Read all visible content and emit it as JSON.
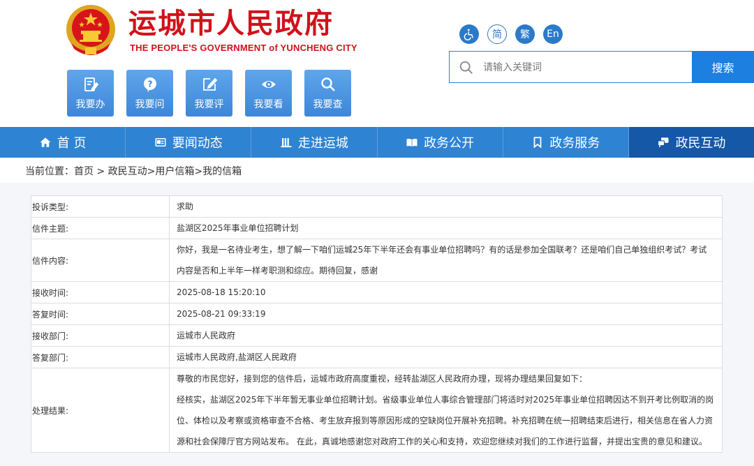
{
  "header": {
    "title": "运城市人民政府",
    "subtitle": "THE PEOPLE'S GOVERNMENT of YUNCHENG CITY",
    "quick_links": [
      {
        "label": "我要办",
        "icon": "edit-document-icon"
      },
      {
        "label": "我要问",
        "icon": "question-bubble-icon"
      },
      {
        "label": "我要评",
        "icon": "pencil-square-icon"
      },
      {
        "label": "我要看",
        "icon": "eye-icon"
      },
      {
        "label": "我要查",
        "icon": "search-icon"
      }
    ],
    "tools": {
      "accessibility_icon": "wheelchair-icon",
      "simplified": "简",
      "traditional": "繁",
      "english": "En"
    },
    "search": {
      "placeholder": "请输入关键词",
      "button_label": "搜索"
    }
  },
  "nav": {
    "items": [
      {
        "label": "首 页",
        "icon": "home-icon",
        "active": false
      },
      {
        "label": "要闻动态",
        "icon": "news-icon",
        "active": false
      },
      {
        "label": "走进运城",
        "icon": "building-icon",
        "active": false
      },
      {
        "label": "政务公开",
        "icon": "book-icon",
        "active": false
      },
      {
        "label": "政务服务",
        "icon": "bookmark-icon",
        "active": false
      },
      {
        "label": "政民互动",
        "icon": "chat-icon",
        "active": true
      }
    ]
  },
  "breadcrumb": {
    "prefix": "当前位置：",
    "home": "首页",
    "sep1": " > ",
    "section": "政民互动",
    "sep2": ">",
    "sub": "用户信箱",
    "sep3": ">",
    "current": "我的信箱"
  },
  "letter": {
    "rows": [
      {
        "label": "投诉类型:",
        "value": "求助"
      },
      {
        "label": "信件主题:",
        "value": "盐湖区2025年事业单位招聘计划"
      },
      {
        "label": "信件内容:",
        "value": "你好，我是一名待业考生，想了解一下咱们运城25年下半年还会有事业单位招聘吗？有的话是参加全国联考？还是咱们自己单独组织考试？考试内容是否和上半年一样考职测和综应。期待回复，感谢"
      },
      {
        "label": "接收时间:",
        "value": "2025-08-18 15:20:10"
      },
      {
        "label": "答复时间:",
        "value": "2025-08-21 09:33:19"
      },
      {
        "label": "接收部门:",
        "value": "运城市人民政府"
      },
      {
        "label": "答复部门:",
        "value": "运城市人民政府,盐湖区人民政府"
      }
    ],
    "result_label": "处理结果:",
    "result_paragraphs": [
      "尊敬的市民您好，接到您的信件后，运城市政府高度重视，经转盐湖区人民政府办理，现将办理结果回复如下：",
      "经核实，盐湖区2025年下半年暂无事业单位招聘计划。省级事业单位人事综合管理部门将适时对2025年事业单位招聘因达不到开考比例取消的岗位、体检以及考察或资格审查不合格、考生放弃报到等原因形成的空缺岗位开展补充招聘。补充招聘在统一招聘结束后进行，相关信息在省人力资源和社会保障厅官方网站发布。 在此，真诚地感谢您对政府工作的关心和支持，欢迎您继续对我们的工作进行监督，并提出宝贵的意见和建议。"
    ]
  },
  "colors": {
    "brand_red": "#d0121b",
    "nav_blue": "#2e83d3",
    "nav_active": "#1558a7",
    "search_blue": "#1d7fe0"
  }
}
